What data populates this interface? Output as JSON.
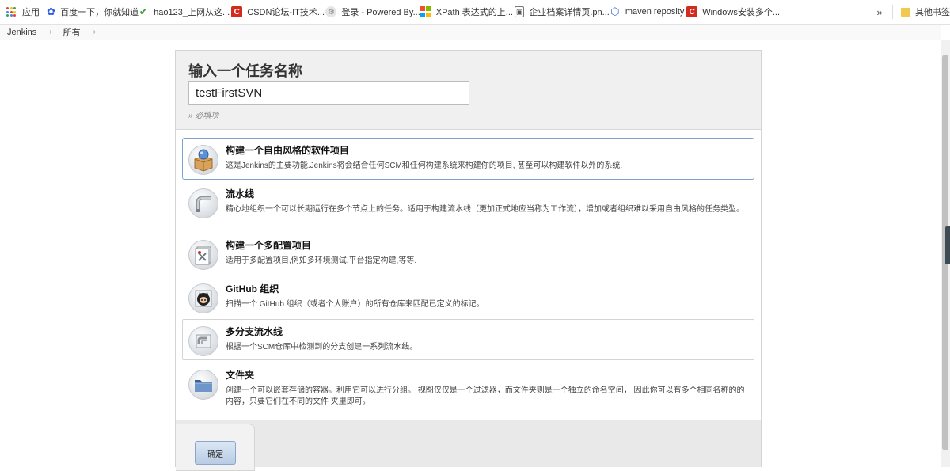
{
  "bookmarks": [
    {
      "label": "应用",
      "icon": "apps-grid-icon"
    },
    {
      "label": "百度一下，你就知道",
      "icon": "baidu-paw-icon"
    },
    {
      "label": "hao123_上网从这...",
      "icon": "hao123-check-icon"
    },
    {
      "label": "CSDN论坛-IT技术...",
      "icon": "csdn-icon"
    },
    {
      "label": "登录 - Powered By...",
      "icon": "powered-by-icon"
    },
    {
      "label": "XPath 表达式的上...",
      "icon": "windows-logo-icon"
    },
    {
      "label": "企业档案详情页.pn...",
      "icon": "image-file-icon"
    },
    {
      "label": "maven reposity",
      "icon": "maven-hexagon-icon"
    },
    {
      "label": "Windows安装多个...",
      "icon": "csdn-icon"
    }
  ],
  "bookmarks_overflow": "»",
  "other_bookmarks": "其他书签",
  "breadcrumb": {
    "root": "Jenkins",
    "current": "所有",
    "sep": "›"
  },
  "form": {
    "title": "输入一个任务名称",
    "item_name_value": "testFirstSVN",
    "required_hint": "» 必填项"
  },
  "item_types": [
    {
      "name": "构建一个自由风格的软件项目",
      "desc": "这是Jenkins的主要功能.Jenkins将会结合任何SCM和任何构建系统来构建你的项目, 甚至可以构建软件以外的系统.",
      "icon": "freestyle-box-icon"
    },
    {
      "name": "流水线",
      "desc": "精心地组织一个可以长期运行在多个节点上的任务。适用于构建流水线（更加正式地应当称为工作流），增加或者组织难以采用自由风格的任务类型。",
      "icon": "pipeline-icon"
    },
    {
      "name": "构建一个多配置项目",
      "desc": "适用于多配置项目,例如多环境测试,平台指定构建,等等.",
      "icon": "multi-config-icon"
    },
    {
      "name": "GitHub 组织",
      "desc": "扫描一个 GitHub 组织（或者个人账户）的所有仓库来匹配已定义的标记。",
      "icon": "github-octocat-icon"
    },
    {
      "name": "多分支流水线",
      "desc": "根据一个SCM仓库中检测到的分支创建一系列流水线。",
      "icon": "multibranch-pipeline-icon"
    },
    {
      "name": "文件夹",
      "desc": "创建一个可以嵌套存储的容器。利用它可以进行分组。 视图仅仅是一个过滤器，而文件夹则是一个独立的命名空间， 因此你可以有多个相同名称的的内容，只要它们在不同的文件 夹里即可。",
      "icon": "folder-icon"
    }
  ],
  "ok_button": "确定"
}
